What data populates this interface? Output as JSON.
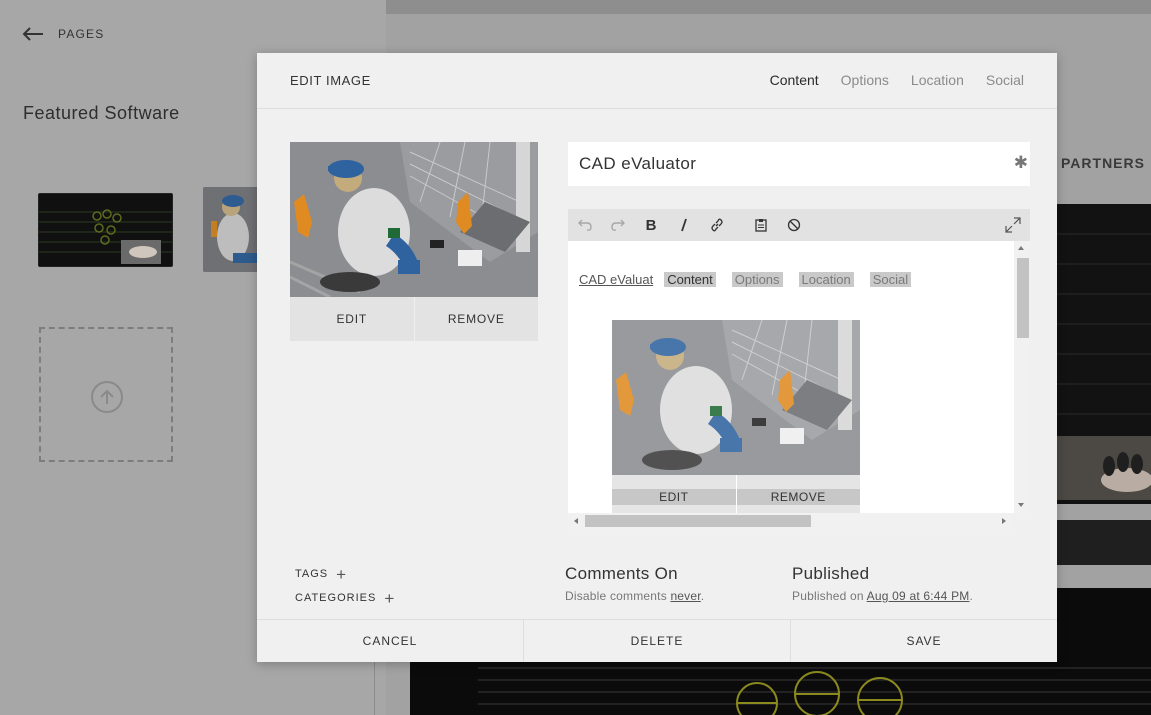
{
  "background": {
    "back_label": "PAGES",
    "section_title": "Featured Software",
    "partners_label": "PARTNERS"
  },
  "modal": {
    "title": "EDIT IMAGE",
    "tabs": [
      {
        "label": "Content",
        "active": true
      },
      {
        "label": "Options",
        "active": false
      },
      {
        "label": "Location",
        "active": false
      },
      {
        "label": "Social",
        "active": false
      }
    ],
    "image_actions": {
      "edit_label": "EDIT",
      "remove_label": "REMOVE"
    },
    "title_field": {
      "value": "CAD eValuator",
      "required_icon": "asterisk-icon"
    },
    "editor": {
      "toolbar_icons": [
        "undo-icon",
        "redo-icon",
        "bold-icon",
        "italic-icon",
        "link-icon",
        "paste-icon",
        "clear-format-icon",
        "fullscreen-icon"
      ],
      "nested_content": {
        "link_text": "CAD eValuat",
        "tabs": [
          "Content",
          "Options",
          "Location",
          "Social"
        ],
        "edit_label": "EDIT",
        "remove_label": "REMOVE"
      }
    },
    "tags_label": "TAGS",
    "categories_label": "CATEGORIES",
    "comments": {
      "title": "Comments On",
      "prefix": "Disable comments ",
      "link": "never",
      "suffix": "."
    },
    "published": {
      "title": "Published",
      "prefix": "Published on ",
      "link": "Aug 09 at 6:44 PM",
      "suffix": "."
    },
    "footer": {
      "cancel": "CANCEL",
      "delete": "DELETE",
      "save": "SAVE"
    }
  }
}
